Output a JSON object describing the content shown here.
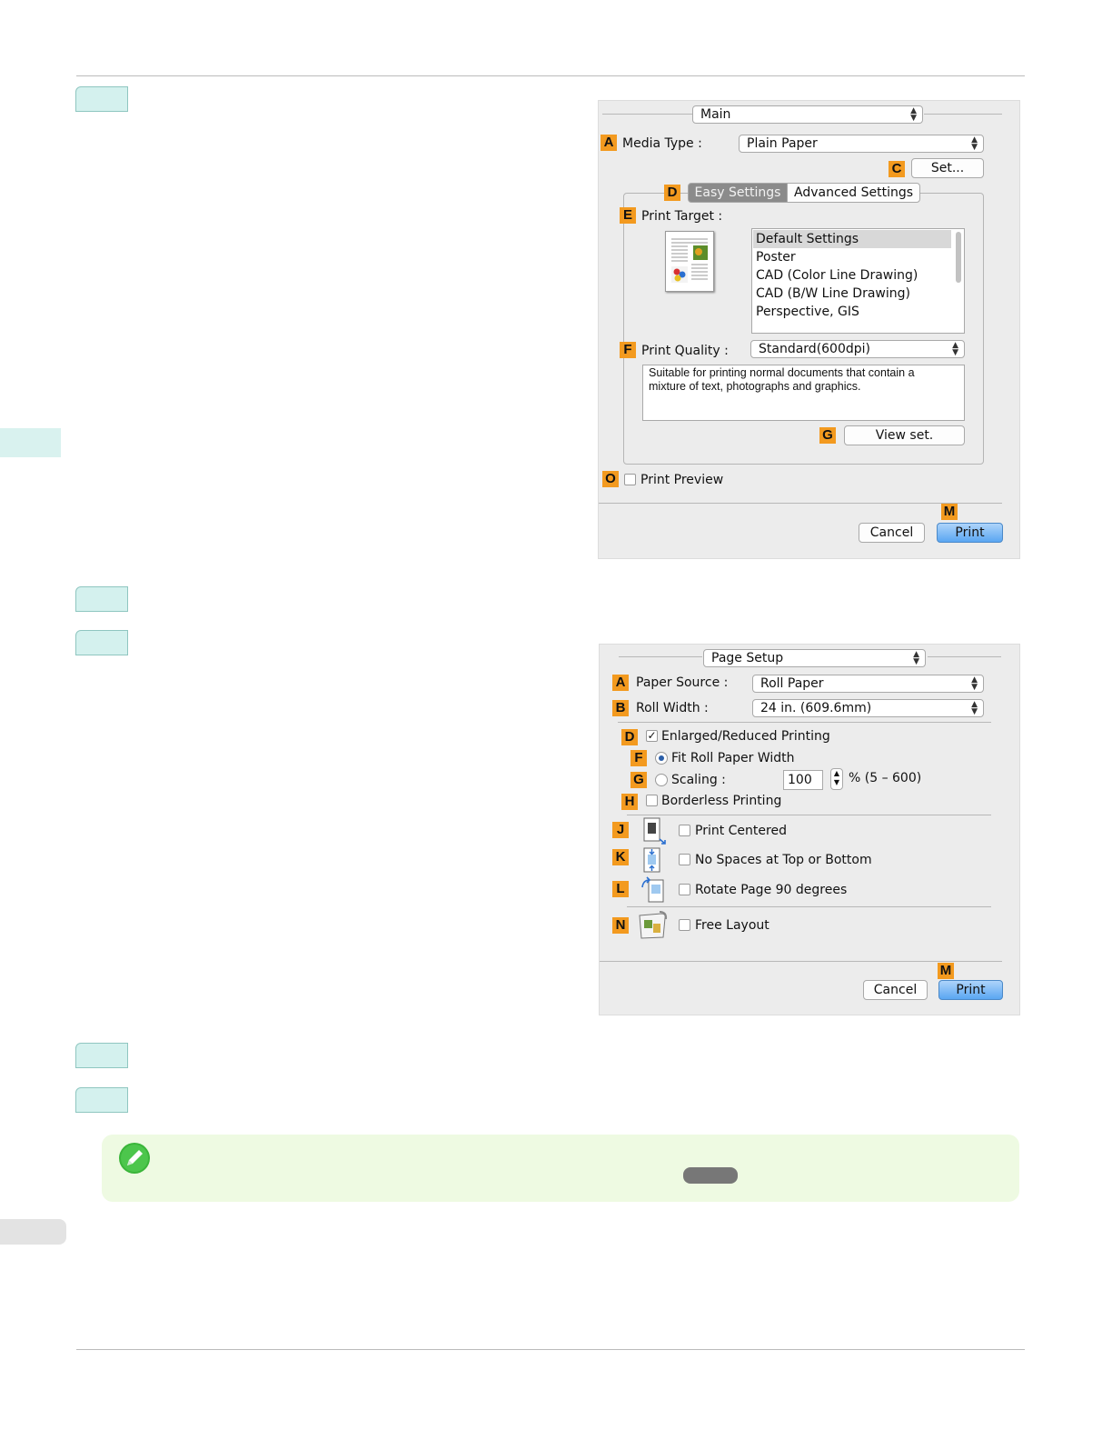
{
  "dialog1": {
    "panel_select": "Main",
    "media_type": {
      "marker": "A",
      "label": "Media Type :",
      "value": "Plain Paper"
    },
    "set_button": {
      "marker": "C",
      "label": "Set..."
    },
    "tabs": {
      "marker": "D",
      "items": [
        "Easy Settings",
        "Advanced Settings"
      ]
    },
    "print_target": {
      "marker": "E",
      "label": "Print Target :",
      "items": [
        "Default Settings",
        "Poster",
        "CAD (Color Line Drawing)",
        "CAD (B/W Line Drawing)",
        "Perspective, GIS"
      ]
    },
    "print_quality": {
      "marker": "F",
      "label": "Print Quality :",
      "value": "Standard(600dpi)",
      "description": "Suitable for printing normal documents that contain a mixture of text, photographs and graphics."
    },
    "view_set": {
      "marker": "G",
      "label": "View set."
    },
    "print_preview": {
      "marker": "O",
      "label": "Print Preview"
    },
    "cancel_label": "Cancel",
    "print": {
      "marker": "M",
      "label": "Print"
    }
  },
  "dialog2": {
    "panel_select": "Page Setup",
    "paper_source": {
      "marker": "A",
      "label": "Paper Source :",
      "value": "Roll Paper"
    },
    "roll_width": {
      "marker": "B",
      "label": "Roll Width :",
      "value": "24 in. (609.6mm)"
    },
    "enlarged": {
      "marker": "D",
      "label": "Enlarged/Reduced Printing",
      "check": "✓"
    },
    "fit_roll": {
      "marker": "F",
      "label": "Fit Roll Paper Width"
    },
    "scaling": {
      "marker": "G",
      "label": "Scaling :",
      "value": "100",
      "range": "% (5 – 600)"
    },
    "borderless": {
      "marker": "H",
      "label": "Borderless Printing"
    },
    "print_centered": {
      "marker": "J",
      "label": "Print Centered"
    },
    "no_spaces": {
      "marker": "K",
      "label": "No Spaces at Top or Bottom"
    },
    "rotate": {
      "marker": "L",
      "label": "Rotate Page 90 degrees"
    },
    "free_layout": {
      "marker": "N",
      "label": "Free Layout"
    },
    "cancel_label": "Cancel",
    "print": {
      "marker": "M",
      "label": "Print"
    }
  },
  "colors": {
    "marker": "#f39a1f",
    "step_tab": "#d4f1ee",
    "note_bg": "#eefae2",
    "print_button": "#5aa6f2"
  },
  "icons": [
    "note-pencil-icon",
    "print-centered-icon",
    "no-spaces-icon",
    "rotate-page-icon",
    "free-layout-icon",
    "document-preview-icon"
  ]
}
